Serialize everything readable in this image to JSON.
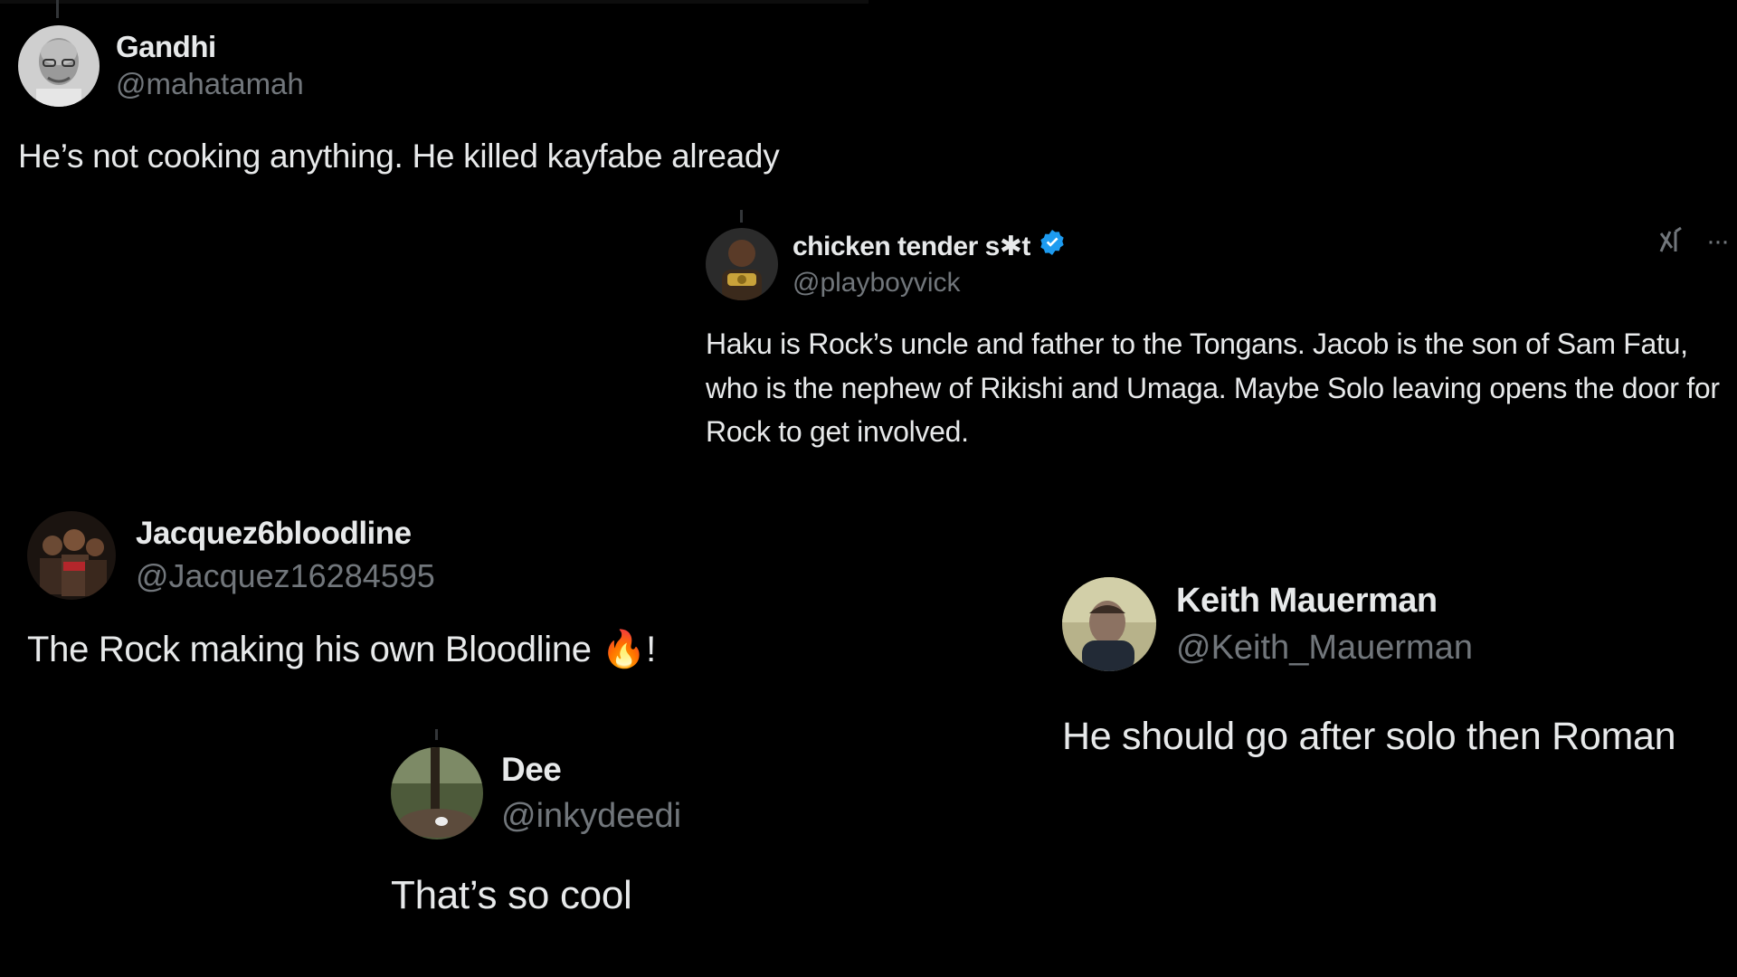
{
  "tweets": [
    {
      "display_name": "Gandhi",
      "handle": "@mahatamah",
      "text": "He’s not cooking anything. He killed kayfabe already"
    },
    {
      "display_name": "chicken tender s✱t",
      "handle": "@playboyvick",
      "text": "Haku is Rock’s uncle and father to the Tongans. Jacob is the son of Sam Fatu, who is the nephew of Rikishi and Umaga. Maybe Solo leaving opens the door for Rock to get involved.",
      "verified": true,
      "grok_icon": "grok-icon",
      "more_icon": "more-icon",
      "more_label": "···"
    },
    {
      "display_name": "Jacquez6bloodline",
      "handle": "@Jacquez16284595",
      "text": "The Rock making his own Bloodline ",
      "emoji": "🔥",
      "suffix": "!"
    },
    {
      "display_name": "Keith Mauerman",
      "handle": "@Keith_Mauerman",
      "text": "He should go after solo then Roman"
    },
    {
      "display_name": "Dee",
      "handle": "@inkydeedi",
      "text": "That’s so cool"
    }
  ],
  "colors": {
    "background": "#000000",
    "text_primary": "#e7e9ea",
    "text_secondary": "#71767b",
    "verified_blue": "#1d9bf0"
  }
}
